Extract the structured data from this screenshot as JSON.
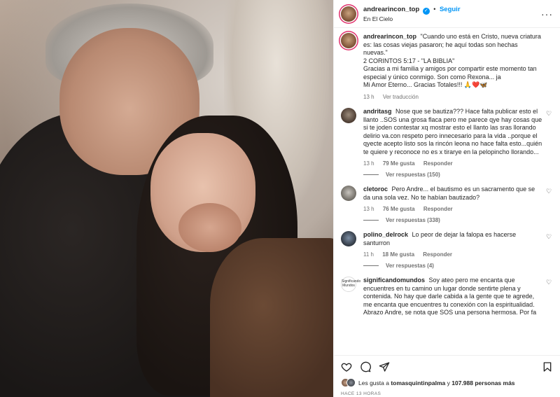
{
  "header": {
    "username": "andrearincon_top",
    "follow_label": "Seguir",
    "location": "En El Cielo",
    "separator": "•"
  },
  "caption": {
    "username": "andrearincon_top",
    "text_line1": "\"Cuando uno está en Cristo, nueva criatura es: las cosas viejas pasaron; he aquí todas son hechas nuevas.\"",
    "text_line2": "2 CORINTOS 5:17 - \"LA BIBLIA\"",
    "text_line3": "Gracias a mi familia y amigos por compartir este momento tan especial y único conmigo. Son como Rexona... ja",
    "text_line4": "Mi Amor Eterno... Gracias Totales!!! 🙏❤️🦋",
    "time": "13 h",
    "translate_label": "Ver traducción"
  },
  "comments": [
    {
      "username": "andritasg",
      "text": "Nose que se bautiza??? Hace falta publicar esto el llanto ..SOS una grosa flaca pero me parece qye hay cosas que si te joden contestar xq mostrar esto el llanto las sras llorando delirio va.con respeto pero innecesario para la vida ..porque el qyecte acepto listo sos la rincón leona no hace falta esto...quién te quiere y reconoce no es x tirarye en la pelopincho llorando...",
      "time": "13 h",
      "likes": "79 Me gusta",
      "reply_label": "Responder",
      "view_replies": "Ver respuestas (150)"
    },
    {
      "username": "cletoroc",
      "text": "Pero Andre... el bautismo es un sacramento que se da una sola vez. No te habían bautizado?",
      "time": "13 h",
      "likes": "76 Me gusta",
      "reply_label": "Responder",
      "view_replies": "Ver respuestas (338)"
    },
    {
      "username": "polino_delrock",
      "text": "Lo peor de dejar la falopa es hacerse santurron",
      "time": "11 h",
      "likes": "18 Me gusta",
      "reply_label": "Responder",
      "view_replies": "Ver respuestas (4)"
    },
    {
      "username": "significandomundos",
      "text": "Soy ateo pero me encanta que encuentres en tu camino un lugar donde sentirte plena y contenida. No hay que darle cabida a la gente que te agrede, me encanta que encuentres tu conexión con la espiritualidad. Abrazo Andre, se nota que SOS una persona hermosa. Por fa",
      "avatar_text": "Significando Mundos"
    }
  ],
  "likes_bar": {
    "prefix": "Les gusta a",
    "user": "tomasquintinpalma",
    "middle": "y",
    "count": "107.988 personas más"
  },
  "timestamp": "HACE 13 HORAS",
  "icons": [
    "heart-icon",
    "comment-icon",
    "share-icon",
    "save-icon",
    "more-icon",
    "verified-icon"
  ],
  "colors": {
    "accent": "#0095f6",
    "text": "#262626",
    "muted": "#737373"
  }
}
